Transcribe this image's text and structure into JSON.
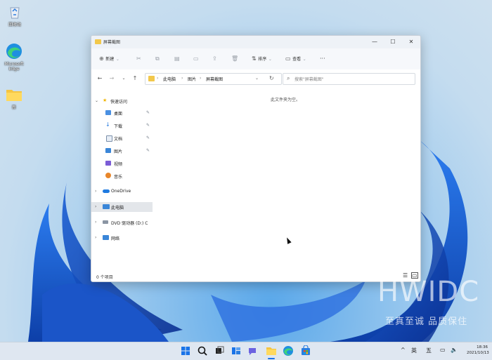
{
  "desktop": {
    "icons": [
      {
        "label": "回收站",
        "icon": "recycle-bin-icon"
      },
      {
        "label": "Microsoft Edge",
        "icon": "edge-icon"
      },
      {
        "label": "新",
        "icon": "folder-icon"
      }
    ]
  },
  "explorer": {
    "title": "屏幕截图",
    "window_controls": {
      "minimize": "—",
      "maximize": "☐",
      "close": "✕"
    },
    "toolbar": {
      "new_label": "新建",
      "sort_label": "排序",
      "view_label": "查看",
      "more_label": "···"
    },
    "nav": {
      "back": "←",
      "forward": "→",
      "history": "⌄",
      "up": "↑"
    },
    "address": {
      "segments": [
        "此电脑",
        "图片",
        "屏幕截图"
      ],
      "separator": "›",
      "dropdown": "⌄",
      "refresh": "↻"
    },
    "search": {
      "placeholder": "搜索\"屏幕截图\""
    },
    "sidebar": {
      "quick_access": "快速访问",
      "quick_items": [
        {
          "label": "桌面",
          "pinned": true
        },
        {
          "label": "下载",
          "pinned": true
        },
        {
          "label": "文档",
          "pinned": true
        },
        {
          "label": "图片",
          "pinned": true
        },
        {
          "label": "视频",
          "pinned": false
        },
        {
          "label": "音乐",
          "pinned": false
        }
      ],
      "pin_glyph": "📌",
      "onedrive": "OneDrive",
      "this_pc": "此电脑",
      "dvd": "DVD 驱动器 (D:) C",
      "network": "网络"
    },
    "content": {
      "empty_message": "此文件夹为空。"
    },
    "status": {
      "item_count": "0 个项目"
    }
  },
  "watermark": {
    "brand": "HWIDC",
    "slogan": "至真至诚 品质保住"
  },
  "taskbar": {
    "tray": {
      "expand": "^",
      "ime_lang": "英",
      "ime_mode": "五"
    },
    "clock_time": "18:36",
    "clock_date": "2021/10/13"
  }
}
